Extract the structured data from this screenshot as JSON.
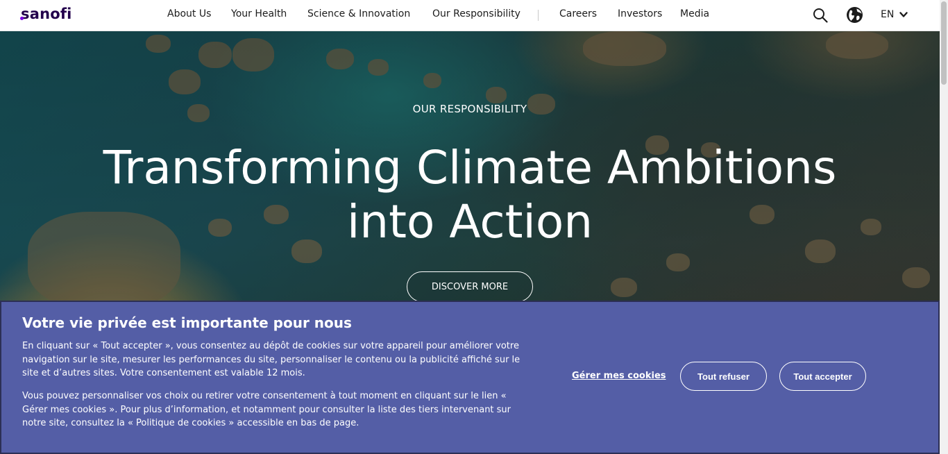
{
  "header": {
    "logo_text": "sanofi",
    "nav": [
      {
        "label": "About Us"
      },
      {
        "label": "Your Health"
      },
      {
        "label": "Science & Innovation"
      },
      {
        "label": "Our Responsibility"
      },
      {
        "label": "Careers"
      },
      {
        "label": "Investors"
      },
      {
        "label": "Media"
      }
    ],
    "search_icon": "search-icon",
    "globe_icon": "globe-icon",
    "language": "EN",
    "language_chevron": "chevron-down-icon"
  },
  "hero": {
    "eyebrow": "OUR RESPONSIBILITY",
    "title_line1": "Transforming Climate Ambitions",
    "title_line2": "into Action",
    "cta": "DISCOVER MORE"
  },
  "cookie_banner": {
    "title": "Votre vie privée est importante pour nous",
    "paragraph1": "En cliquant sur « Tout accepter », vous consentez au dépôt de cookies sur votre appareil pour améliorer votre navigation sur le site, mesurer les performances du site, personnaliser le contenu ou la publicité affiché sur le site et d’autres sites. Votre consentement est valable 12 mois.",
    "paragraph2": "Vous pouvez personnaliser vos choix ou retirer votre consentement à tout moment en cliquant sur le lien « Gérer mes cookies ». Pour plus d’information, et notamment pour consulter la liste des tiers intervenant sur notre site, consultez la « Politique de cookies » accessible en bas de page.",
    "manage_label": "Gérer mes cookies",
    "refuse_label": "Tout refuser",
    "accept_label": "Tout accepter"
  },
  "colors": {
    "logo": "#23004c",
    "logo_dot": "#7a00e6",
    "banner_bg": "#545ea6",
    "banner_border": "#2c2f55"
  }
}
